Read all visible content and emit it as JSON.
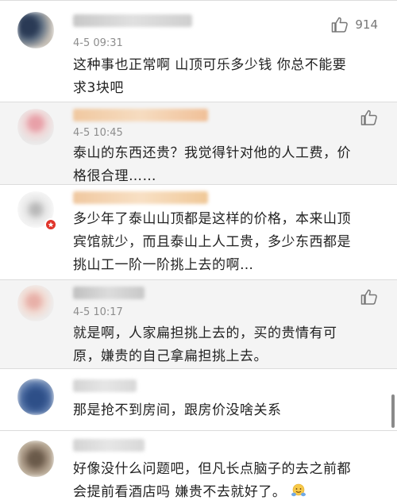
{
  "comments": [
    {
      "timestamp": "4-5 09:31",
      "likes": "914",
      "text_lines": [
        "这种事也正常啊 山顶可乐多少钱 你总不能要",
        "求3块吧"
      ]
    },
    {
      "timestamp": "4-5 10:45",
      "text_lines": [
        "泰山的东西还贵？我觉得针对他的人工费，价",
        "格很合理……"
      ]
    },
    {
      "text_lines": [
        "多少年了泰山山顶都是这样的价格，本来山顶",
        "宾馆就少，而且泰山上人工贵，多少东西都是",
        "挑山工一阶一阶挑上去的啊…"
      ]
    },
    {
      "timestamp": "4-5 10:17",
      "text_lines": [
        "就是啊，人家扁担挑上去的，买的贵情有可",
        "原，嫌贵的自己拿扁担挑上去。"
      ]
    },
    {
      "text_lines": [
        "那是抢不到房间，跟房价没啥关系"
      ]
    },
    {
      "text_lines": [
        "好像没什么问题吧，但凡长点脑子的去之前都",
        "会提前看酒店吗 嫌贵不去就好了。"
      ]
    }
  ],
  "icons": {
    "like": "thumbs-up-icon",
    "emoji": "hugging-face-emoji",
    "verified": "verified-badge-icon"
  },
  "colors": {
    "reply_background": "#f4f4f4",
    "timestamp": "#8d8d8d",
    "badge": "#e0352b"
  }
}
